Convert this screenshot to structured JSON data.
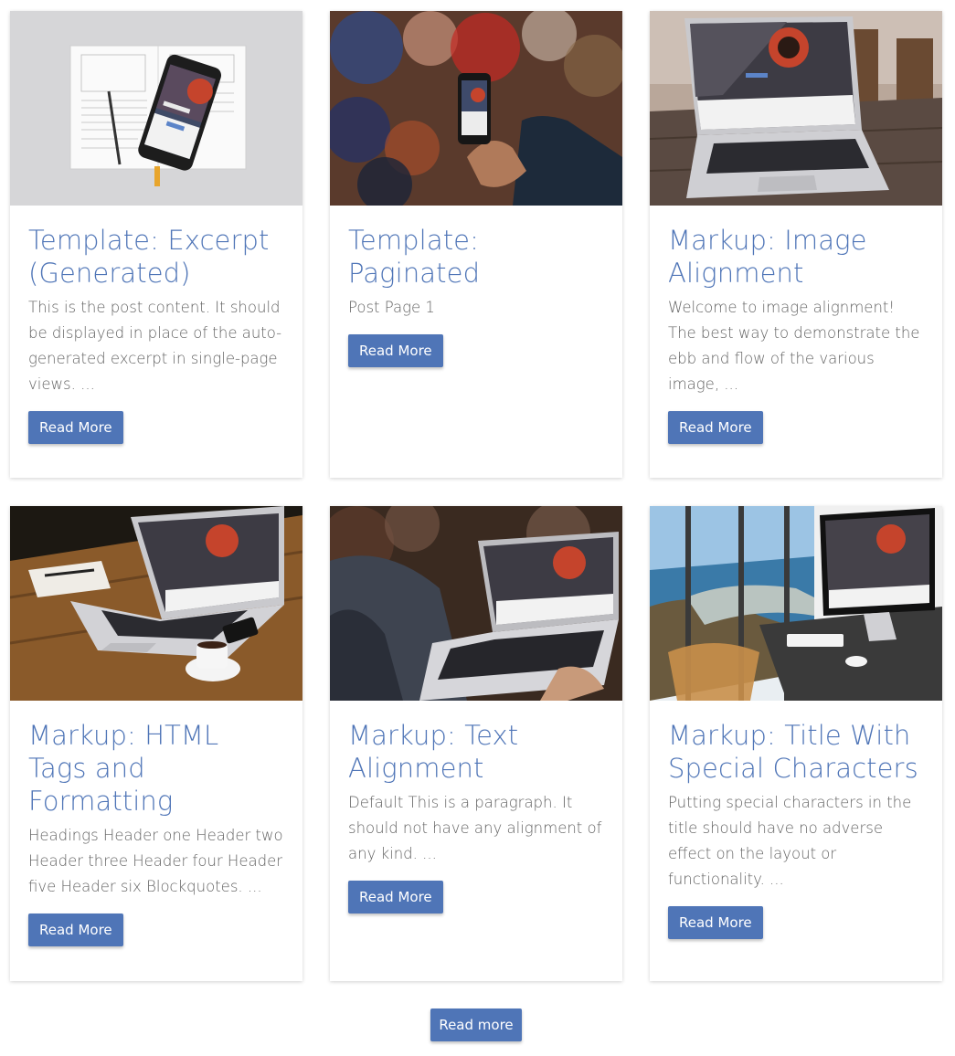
{
  "posts": [
    {
      "title": "Template: Excerpt (Generated)",
      "excerpt": "This is the post content. It should be displayed in place of the auto-generated excerpt in single-page views. ...",
      "button": "Read More",
      "image": "notebook-and-phone-photo"
    },
    {
      "title": "Template: Paginated",
      "excerpt": "Post Page 1",
      "button": "Read More",
      "image": "hand-holding-phone-photo"
    },
    {
      "title": "Markup: Image Alignment",
      "excerpt": "Welcome to image alignment! The best way to demonstrate the ebb and flow of the various image, ...",
      "button": "Read More",
      "image": "laptop-on-table-photo"
    },
    {
      "title": "Markup: HTML Tags and Formatting",
      "excerpt": "Headings Header one Header two Header three Header four Header five Header six Blockquotes. ...",
      "button": "Read More",
      "image": "laptop-and-coffee-photo"
    },
    {
      "title": "Markup: Text Alignment",
      "excerpt": "Default This is a paragraph. It should not have any alignment of any kind. ...",
      "button": "Read More",
      "image": "person-using-laptop-photo"
    },
    {
      "title": "Markup: Title With Special Characters",
      "excerpt": "Putting special characters in the title should have no adverse effect on the layout or functionality. ...",
      "button": "Read More",
      "image": "desktop-by-window-photo"
    }
  ],
  "load_more": "Read more",
  "colors": {
    "accent": "#4f75b7",
    "text": "#626262"
  }
}
